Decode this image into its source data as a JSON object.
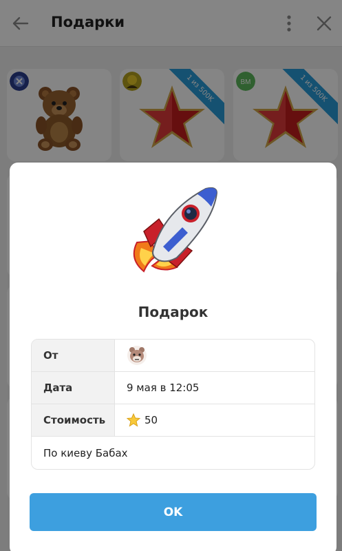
{
  "header": {
    "title": "Подарки"
  },
  "grid": {
    "cards": [
      {
        "sender": "team-icon",
        "gift": "teddy-bear",
        "badge": ""
      },
      {
        "sender": "avatar",
        "gift": "red-star",
        "badge": "1 из 500K"
      },
      {
        "sender_initials": "BM",
        "gift": "red-star",
        "badge": "1 из 500K"
      }
    ]
  },
  "modal": {
    "gift_icon": "rocket-icon",
    "title": "Подарок",
    "rows": [
      {
        "label": "От",
        "value_icon": "user-avatar-icon"
      },
      {
        "label": "Дата",
        "value": "9 мая в 12:05"
      },
      {
        "label": "Стоимость",
        "value_icon": "star-icon",
        "value": "50"
      }
    ],
    "message": "По киеву Бабах",
    "ok_label": "OK"
  },
  "colors": {
    "accent": "#3d9fdf",
    "ribbon": "#2a9bd8"
  }
}
